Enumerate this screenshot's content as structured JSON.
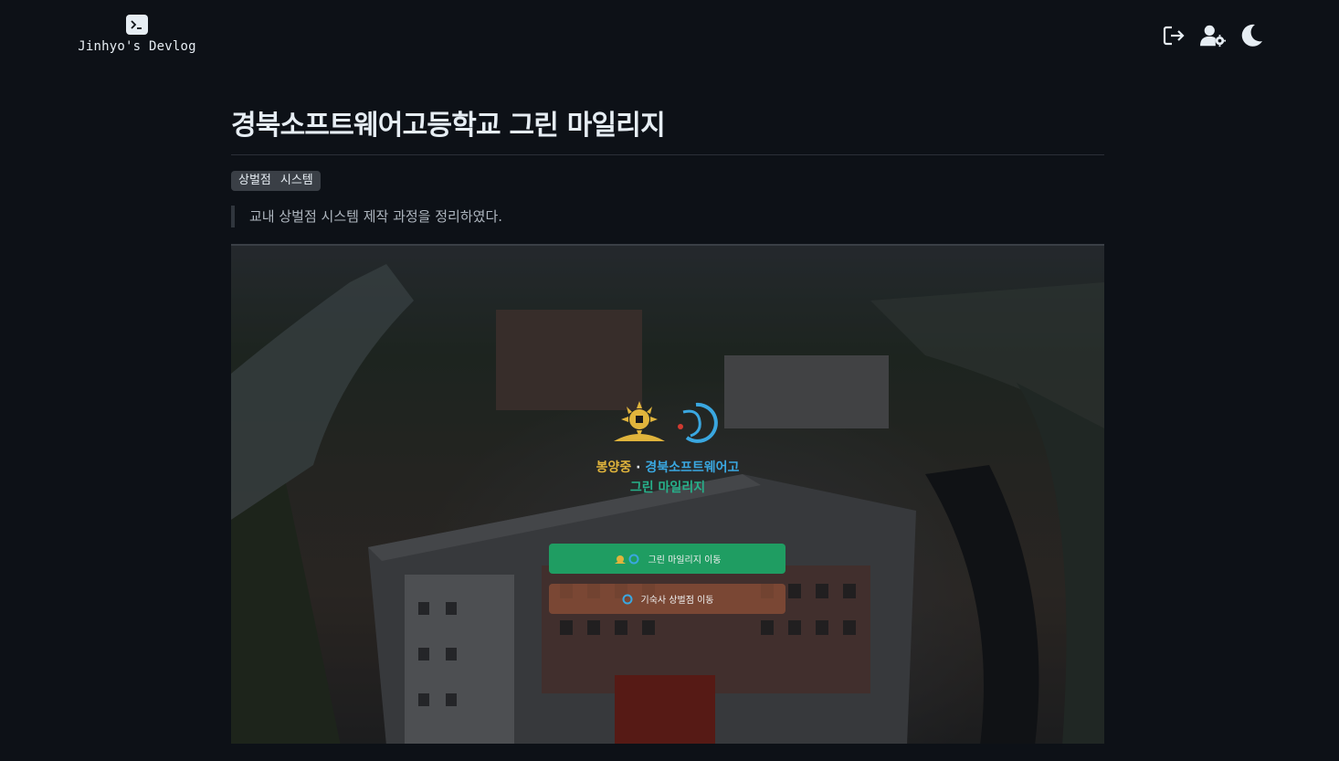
{
  "header": {
    "brand_icon": "terminal-icon",
    "brand_name": "Jinhyo's Devlog",
    "actions": [
      {
        "icon": "logout-icon"
      },
      {
        "icon": "user-settings-icon"
      },
      {
        "icon": "moon-icon"
      }
    ]
  },
  "post": {
    "title": "경북소프트웨어고등학교 그린 마일리지",
    "tags": [
      "상벌점",
      "시스템"
    ],
    "summary": "교내 상벌점 시스템 제작 과정을 정리하였다."
  },
  "hero": {
    "line1_school_a": "봉양중",
    "line1_separator": "·",
    "line1_school_b": "경북소프트웨어고",
    "line2": "그린 마일리지",
    "button_green_label": "그린 마일리지 이동",
    "button_brown_label": "기숙사 상벌점 이동",
    "colors": {
      "accent_green": "#1f9d62",
      "accent_yellow": "#e0b43c",
      "accent_blue": "#3aa7e0"
    }
  }
}
